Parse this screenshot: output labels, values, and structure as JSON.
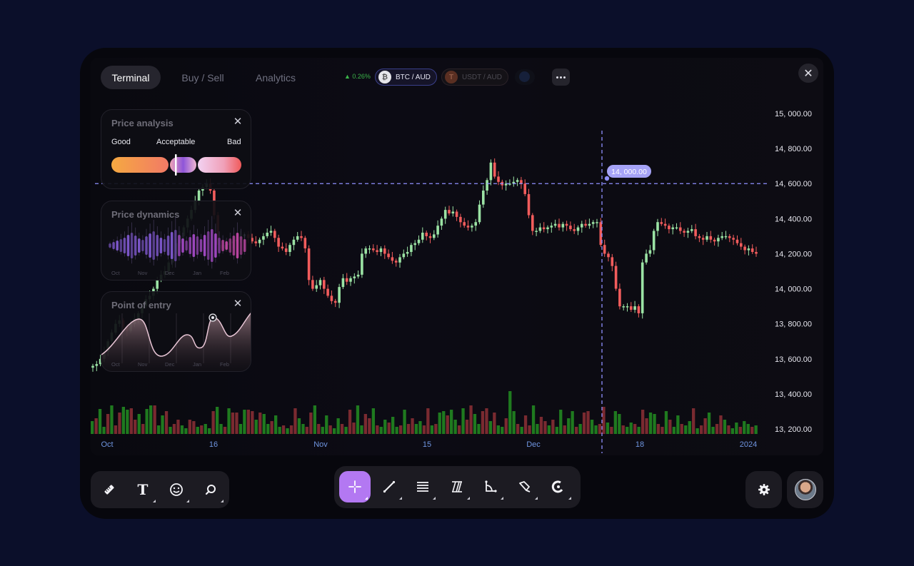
{
  "tabs": [
    {
      "label": "Terminal",
      "active": true
    },
    {
      "label": "Buy / Sell",
      "active": false
    },
    {
      "label": "Analytics",
      "active": false
    }
  ],
  "ticker": {
    "change": "▲ 0.26%",
    "pairs": [
      {
        "label": "BTC / AUD",
        "icon": "bitcoin-icon",
        "active": true
      },
      {
        "label": "USDT / AUD",
        "icon": "tether-icon",
        "active": false
      }
    ]
  },
  "panels": {
    "price_analysis": {
      "title": "Price analysis",
      "labels": [
        "Good",
        "Acceptable",
        "Bad"
      ]
    },
    "price_dynamics": {
      "title": "Price dynamics",
      "months": [
        "Oct",
        "Nov",
        "Dec",
        "Jan",
        "Feb"
      ]
    },
    "point_of_entry": {
      "title": "Point of entry",
      "months": [
        "Oct",
        "Nov",
        "Dec",
        "Jan",
        "Feb"
      ]
    }
  },
  "crosshair_label": "14, 000.00",
  "chart_data": {
    "type": "candlestick",
    "y_axis_ticks": [
      "15, 000.00",
      "14, 800.00",
      "14, 600.00",
      "14, 400.00",
      "14, 200.00",
      "14, 000.00",
      "13, 800.00",
      "13, 600.00",
      "13, 400.00",
      "13, 200.00"
    ],
    "x_axis_ticks": [
      "Oct",
      "16",
      "Nov",
      "15",
      "Dec",
      "18",
      "2024"
    ],
    "ylim": [
      13200,
      15000
    ],
    "crosshair_price": 14600,
    "colors": {
      "up": "#9be3a4",
      "down": "#f25c5c",
      "vol_up": "#1f7a1f",
      "vol_down": "#7a2a30",
      "crosshair": "#8f90ff"
    },
    "closes": [
      13560,
      13570,
      13600,
      13640,
      13700,
      13750,
      13800,
      13820,
      13780,
      13760,
      13800,
      13830,
      13860,
      13900,
      13940,
      13960,
      14000,
      14050,
      14080,
      14100,
      14150,
      14200,
      14260,
      14300,
      14350,
      14400,
      14450,
      14500,
      14560,
      14580,
      14600,
      14560,
      14420,
      14250,
      14230,
      14250,
      14260,
      14270,
      14280,
      14300,
      14310,
      14290,
      14270,
      14260,
      14280,
      14300,
      14320,
      14330,
      14290,
      14240,
      14230,
      14210,
      14250,
      14280,
      14300,
      14290,
      14230,
      14050,
      14000,
      14020,
      14050,
      14000,
      13960,
      13930,
      13920,
      14010,
      14060,
      14040,
      14060,
      14070,
      14080,
      14200,
      14230,
      14230,
      14220,
      14210,
      14230,
      14200,
      14180,
      14160,
      14150,
      14180,
      14200,
      14210,
      14250,
      14260,
      14280,
      14320,
      14300,
      14290,
      14310,
      14360,
      14400,
      14450,
      14430,
      14440,
      14410,
      14380,
      14360,
      14350,
      14360,
      14380,
      14480,
      14560,
      14620,
      14720,
      14640,
      14610,
      14590,
      14600,
      14600,
      14610,
      14620,
      14600,
      14540,
      14420,
      14330,
      14330,
      14350,
      14340,
      14350,
      14360,
      14370,
      14350,
      14370,
      14360,
      14340,
      14330,
      14350,
      14370,
      14360,
      14370,
      14380,
      14380,
      14250,
      14200,
      14180,
      14130,
      14000,
      13900,
      13900,
      13900,
      13880,
      13900,
      13860,
      14150,
      14200,
      14220,
      14330,
      14380,
      14370,
      14360,
      14340,
      14350,
      14350,
      14330,
      14320,
      14330,
      14340,
      14300,
      14290,
      14280,
      14300,
      14280,
      14270,
      14290,
      14300,
      14300,
      14290,
      14280,
      14260,
      14240,
      14220,
      14230,
      14210,
      14200
    ],
    "volumes": [
      18,
      22,
      35,
      10,
      28,
      40,
      12,
      30,
      38,
      34,
      36,
      20,
      28,
      14,
      35,
      40,
      40,
      12,
      26,
      32,
      10,
      14,
      20,
      12,
      8,
      20,
      18,
      10,
      12,
      14,
      8,
      32,
      38,
      14,
      10,
      36,
      30,
      30,
      14,
      34,
      34,
      32,
      20,
      30,
      28,
      14,
      18,
      26,
      10,
      12,
      8,
      12,
      36,
      22,
      14,
      10,
      30,
      40,
      14,
      10,
      26,
      12,
      8,
      22,
      14,
      10,
      34,
      16,
      40,
      12,
      28,
      22,
      36,
      12,
      10,
      20,
      16,
      24,
      10,
      12,
      34,
      14,
      22,
      14,
      18,
      12,
      36,
      12,
      14,
      30,
      32,
      26,
      34,
      20,
      12,
      36,
      20,
      40,
      28,
      14,
      32,
      36,
      18,
      30,
      12,
      10,
      22,
      60,
      32,
      14,
      10,
      26,
      12,
      40,
      14,
      24,
      18,
      12,
      20,
      10,
      34,
      12,
      22,
      32,
      10,
      14,
      30,
      32,
      20,
      12,
      14,
      38,
      16,
      10,
      32,
      28,
      12,
      10,
      16,
      14,
      10,
      34,
      22,
      30,
      28,
      14,
      10,
      32,
      20,
      10,
      26,
      14,
      12,
      18,
      36,
      8,
      12,
      22,
      30,
      10,
      14,
      26,
      20,
      12,
      8,
      16,
      10,
      18,
      14,
      10,
      12
    ]
  }
}
